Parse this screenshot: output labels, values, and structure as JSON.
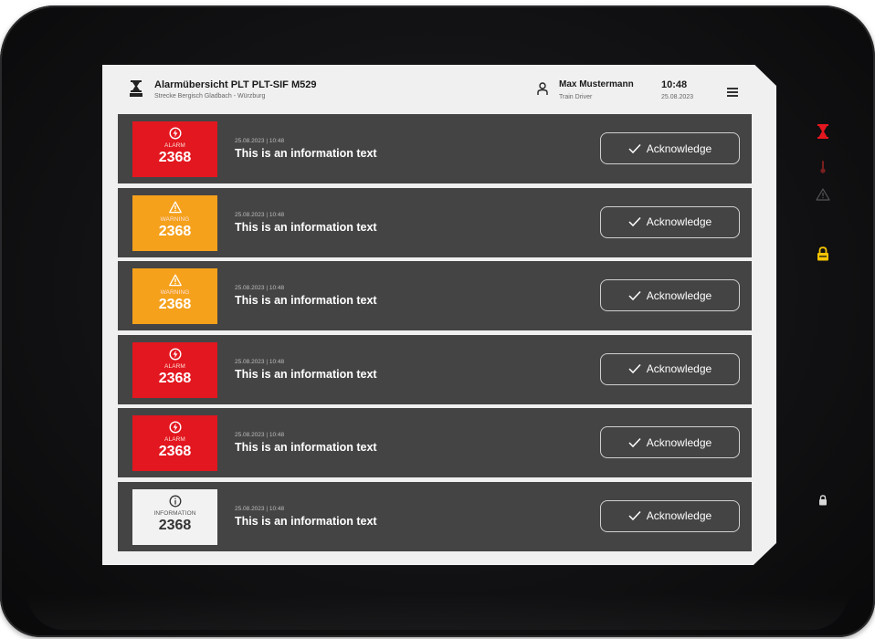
{
  "header": {
    "title": "Alarmübersicht PLT PLT-SIF  M529",
    "subtitle": "Strecke Bergisch Gladbach - Würzburg",
    "user_name": "Max Mustermann",
    "user_role": "Train Driver",
    "time": "10:48",
    "date": "25.08.2023"
  },
  "colors": {
    "alarm": "#e3171f",
    "warning": "#f5a11c",
    "information": "#f2f2f2",
    "row_background": "#444444",
    "lock_indicator": "#f5c400"
  },
  "rows": [
    {
      "type": "ALARM",
      "number": "2368",
      "timestamp": "25.08.2023 | 10:48",
      "text": "This is an information text",
      "ack_label": "Acknowledge",
      "icon": "alarm-icon"
    },
    {
      "type": "WARNING",
      "number": "2368",
      "timestamp": "25.08.2023 | 10:48",
      "text": "This is an information text",
      "ack_label": "Acknowledge",
      "icon": "warning-icon"
    },
    {
      "type": "WARNING",
      "number": "2368",
      "timestamp": "25.08.2023 | 10:48",
      "text": "This is an information text",
      "ack_label": "Acknowledge",
      "icon": "warning-icon"
    },
    {
      "type": "ALARM",
      "number": "2368",
      "timestamp": "25.08.2023 | 10:48",
      "text": "This is an information text",
      "ack_label": "Acknowledge",
      "icon": "alarm-icon"
    },
    {
      "type": "ALARM",
      "number": "2368",
      "timestamp": "25.08.2023 | 10:48",
      "text": "This is an information text",
      "ack_label": "Acknowledge",
      "icon": "alarm-icon"
    },
    {
      "type": "INFORMATION",
      "number": "2368",
      "timestamp": "25.08.2023 | 10:48",
      "text": "This is an information text",
      "ack_label": "Acknowledge",
      "icon": "info-icon"
    }
  ],
  "side_indicators": [
    "hourglass-icon",
    "thermometer-icon",
    "warning-outline-icon",
    "lock-icon",
    "small-indicator-icon"
  ]
}
